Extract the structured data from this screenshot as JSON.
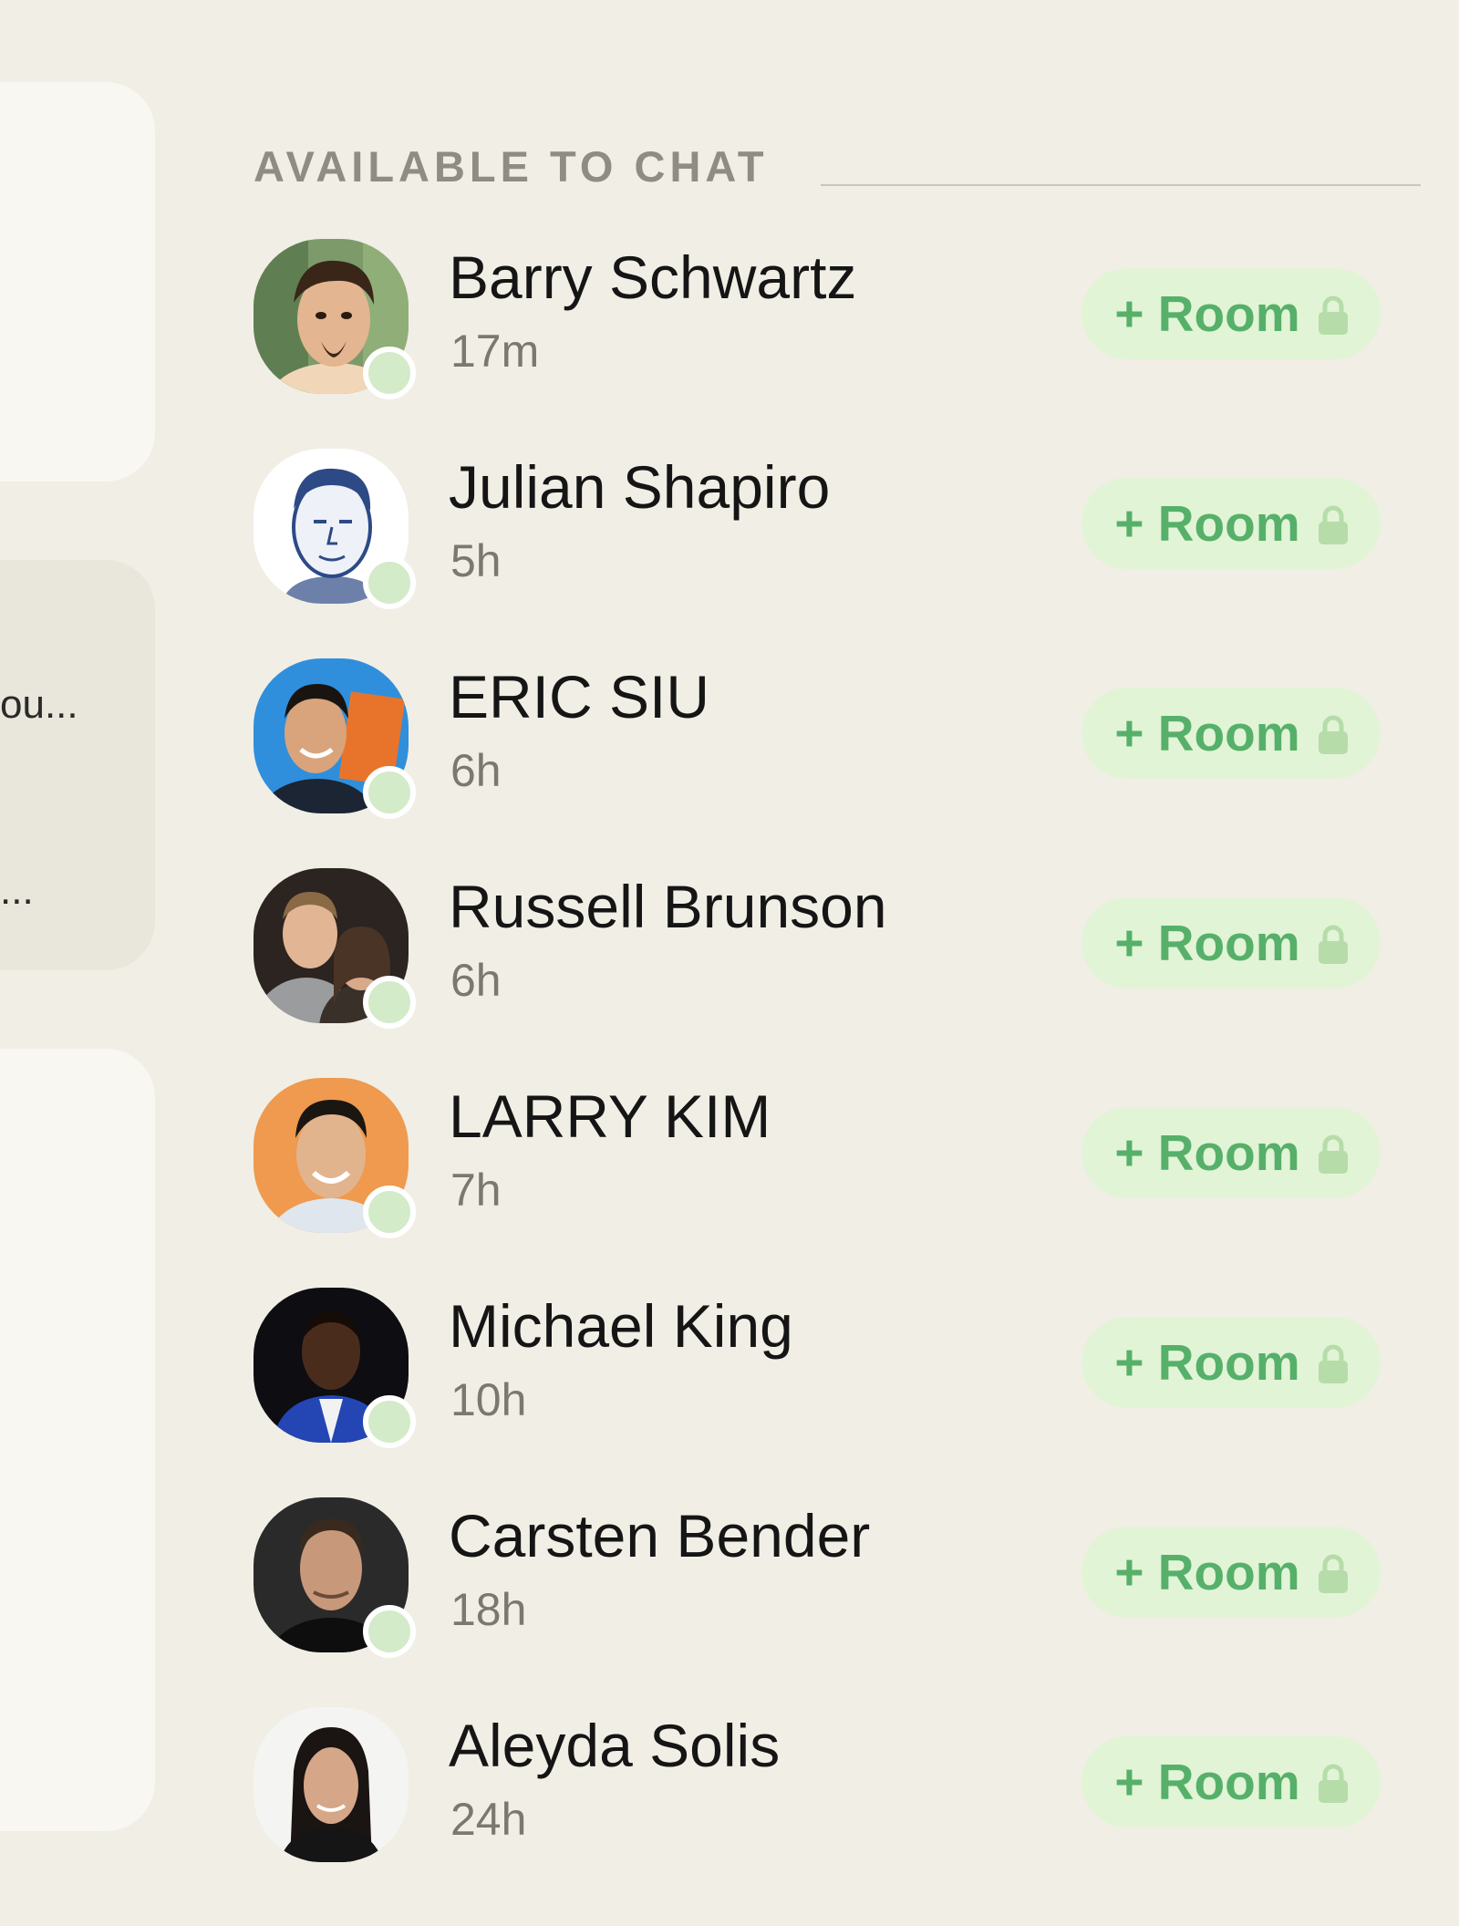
{
  "colors": {
    "background": "#f1eee5",
    "accent_green": "#56b06a",
    "button_bg": "#e2f4d6",
    "online_dot": "#d3ebc8"
  },
  "left_panel": {
    "snippet_1": "ou...",
    "snippet_2": "..."
  },
  "section": {
    "title": "AVAILABLE TO CHAT"
  },
  "contacts": [
    {
      "name": "Barry Schwartz",
      "time": "17m",
      "room_label": "+ Room",
      "icon": "lock-icon",
      "online": true
    },
    {
      "name": "Julian Shapiro",
      "time": "5h",
      "room_label": "+ Room",
      "icon": "lock-icon",
      "online": true
    },
    {
      "name": "ERIC SIU",
      "time": "6h",
      "room_label": "+ Room",
      "icon": "lock-icon",
      "online": true
    },
    {
      "name": "Russell Brunson",
      "time": "6h",
      "room_label": "+ Room",
      "icon": "lock-icon",
      "online": true
    },
    {
      "name": "LARRY KIM",
      "time": "7h",
      "room_label": "+ Room",
      "icon": "lock-icon",
      "online": true
    },
    {
      "name": "Michael King",
      "time": "10h",
      "room_label": "+ Room",
      "icon": "lock-icon",
      "online": true
    },
    {
      "name": "Carsten Bender",
      "time": "18h",
      "room_label": "+ Room",
      "icon": "lock-icon",
      "online": true
    },
    {
      "name": "Aleyda Solis",
      "time": "24h",
      "room_label": "+ Room",
      "icon": "lock-icon",
      "online": false
    }
  ]
}
